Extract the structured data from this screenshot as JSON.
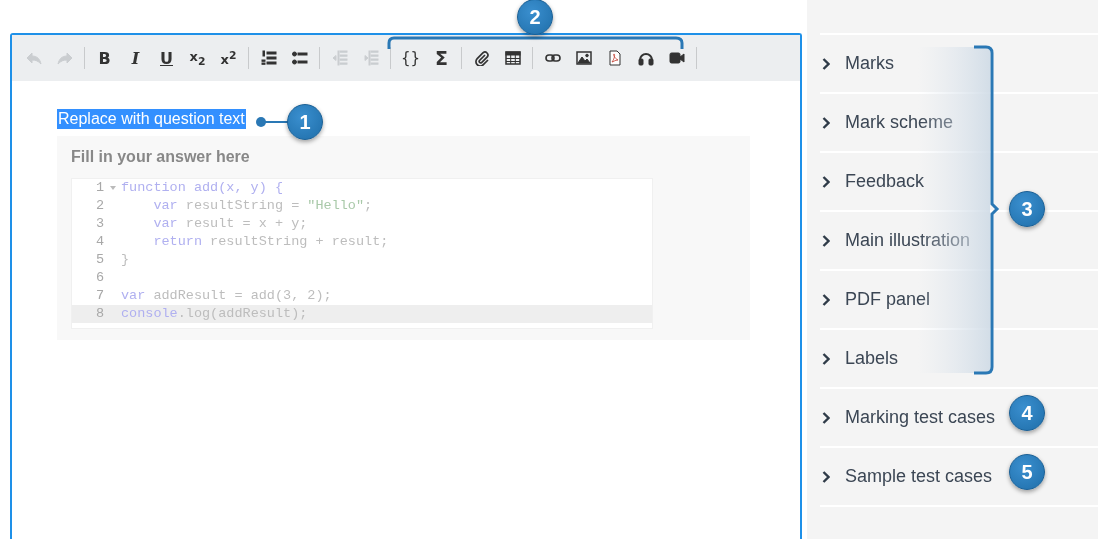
{
  "toolbar": [
    {
      "buttons": [
        {
          "kind": "undo",
          "disabled": true
        },
        {
          "kind": "redo",
          "disabled": true
        }
      ]
    },
    {
      "buttons": [
        {
          "kind": "bold",
          "glyph": "B",
          "disabled": false
        },
        {
          "kind": "italic",
          "glyph": "I",
          "disabled": false
        },
        {
          "kind": "underline",
          "glyph": "U",
          "disabled": false
        },
        {
          "kind": "subscript",
          "glyph": "x$_{2}$",
          "disabled": false
        },
        {
          "kind": "superscript",
          "glyph": "x$^{2}$",
          "disabled": false
        }
      ]
    },
    {
      "buttons": [
        {
          "kind": "numbered-list",
          "disabled": false
        },
        {
          "kind": "bullet-list",
          "disabled": false
        }
      ]
    },
    {
      "buttons": [
        {
          "kind": "outdent",
          "disabled": true
        },
        {
          "kind": "indent",
          "disabled": true
        }
      ]
    },
    {
      "buttons": [
        {
          "kind": "code",
          "glyph": "{}",
          "disabled": false
        },
        {
          "kind": "sum",
          "glyph": "Σ",
          "disabled": false
        }
      ]
    },
    {
      "buttons": [
        {
          "kind": "attachment",
          "disabled": false
        },
        {
          "kind": "table",
          "disabled": false
        }
      ]
    },
    {
      "buttons": [
        {
          "kind": "link",
          "disabled": false
        },
        {
          "kind": "image",
          "disabled": false
        },
        {
          "kind": "pdf",
          "disabled": false
        },
        {
          "kind": "audio",
          "disabled": false
        },
        {
          "kind": "video",
          "disabled": false
        }
      ]
    }
  ],
  "question": {
    "text": "Replace with question text",
    "selected": true
  },
  "answer": {
    "title": "Fill in your answer here",
    "lines": [
      {
        "number": "1",
        "fold": true,
        "active": false,
        "tokens": [
          {
            "kind": "keyword",
            "text": "function add(x, y) {"
          }
        ]
      },
      {
        "number": "2",
        "fold": false,
        "active": false,
        "tokens": [
          {
            "kind": "keyword",
            "text": "    var"
          },
          {
            "kind": "plain",
            "text": " resultString = "
          },
          {
            "kind": "string",
            "text": "\"Hello\""
          },
          {
            "kind": "plain",
            "text": ";"
          }
        ]
      },
      {
        "number": "3",
        "fold": false,
        "active": false,
        "tokens": [
          {
            "kind": "keyword",
            "text": "    var"
          },
          {
            "kind": "plain",
            "text": " result = x + y;"
          }
        ]
      },
      {
        "number": "4",
        "fold": false,
        "active": false,
        "tokens": [
          {
            "kind": "keyword",
            "text": "    return"
          },
          {
            "kind": "plain",
            "text": " resultString + result;"
          }
        ]
      },
      {
        "number": "5",
        "fold": false,
        "active": false,
        "tokens": [
          {
            "kind": "plain",
            "text": "}"
          }
        ]
      },
      {
        "number": "6",
        "fold": false,
        "active": false
      },
      {
        "number": "7",
        "fold": false,
        "active": false,
        "tokens": [
          {
            "kind": "keyword",
            "text": "var"
          },
          {
            "kind": "plain",
            "text": " addResult = add(3, 2);"
          }
        ]
      },
      {
        "number": "8",
        "fold": false,
        "active": true,
        "tokens": [
          {
            "kind": "keyword",
            "text": "console"
          },
          {
            "kind": "plain",
            "text": ".log(addResult);"
          }
        ]
      }
    ]
  },
  "sidebar": {
    "items": [
      {
        "label": "Marks",
        "expanded": false
      },
      {
        "label": "Mark scheme",
        "expanded": false
      },
      {
        "label": "Feedback",
        "expanded": false
      },
      {
        "label": "Main illustration",
        "expanded": false
      },
      {
        "label": "PDF panel",
        "expanded": false
      },
      {
        "label": "Labels",
        "expanded": false
      },
      {
        "label": "Marking test cases",
        "expanded": false
      },
      {
        "label": "Sample test cases",
        "expanded": false
      }
    ]
  },
  "callouts": [
    {
      "number": "1",
      "kind": "pointer"
    },
    {
      "number": "2",
      "kind": "top-bracket"
    },
    {
      "number": "3",
      "kind": "side-bracket"
    },
    {
      "number": "4",
      "kind": "plain"
    },
    {
      "number": "5",
      "kind": "plain"
    }
  ]
}
